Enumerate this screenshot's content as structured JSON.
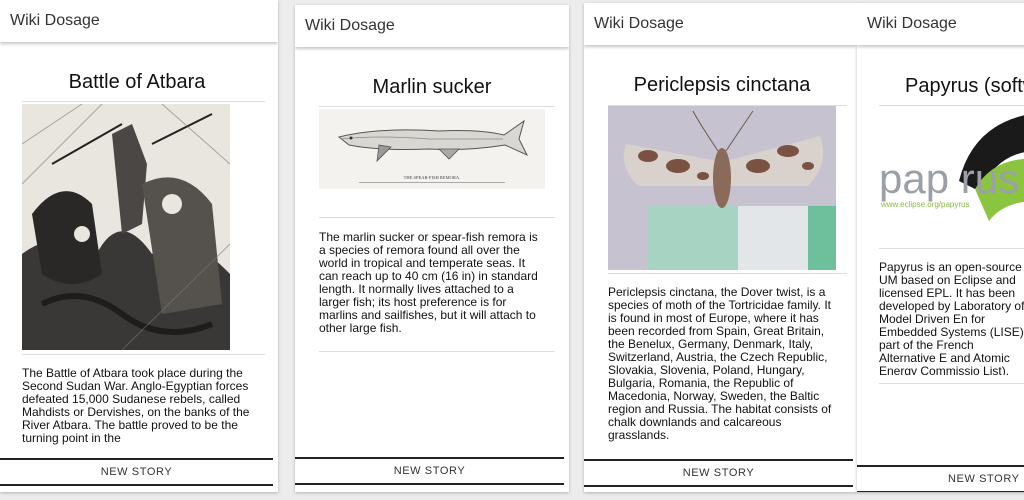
{
  "cards": [
    {
      "app_title": "Wiki Dosage",
      "title": "Battle of Atbara",
      "image_icon": "battle-illustration",
      "summary": "The Battle of Atbara took place during the Second Sudan War. Anglo-Egyptian forces defeated 15,000 Sudanese rebels, called Mahdists or Dervishes, on the banks of the River Atbara. The battle proved to be the turning point in the",
      "button": "NEW STORY"
    },
    {
      "app_title": "Wiki Dosage",
      "title": "Marlin sucker",
      "image_icon": "fish-drawing",
      "image_caption": "THE SPEAR-FISH REMORA.",
      "summary": "The marlin sucker or spear-fish remora is a species of remora found all over the world in tropical and temperate seas. It can reach up to 40 cm (16 in) in standard length. It normally lives attached to a larger fish; its host preference is for marlins and sailfishes, but it will attach to other large fish.",
      "button": "NEW STORY"
    },
    {
      "app_title": "Wiki Dosage",
      "title": "Periclepsis cinctana",
      "image_icon": "moth-photo",
      "summary": "Periclepsis cinctana, the Dover twist, is a species of moth of the Tortricidae family. It is found in most of Europe, where it has been recorded from Spain, Great Britain, the Benelux, Germany, Denmark, Italy, Switzerland, Austria, the Czech Republic, Slovakia, Slovenia, Poland, Hungary, Bulgaria, Romania, the Republic of Macedonia, Norway, Sweden, the Baltic region and Russia. The habitat consists of chalk downlands and calcareous grasslands.",
      "button": "NEW STORY"
    },
    {
      "app_title": "Wiki Dosage",
      "title": "Papyrus (softw",
      "image_icon": "papyrus-logo",
      "logo_text": "pap rus",
      "logo_url": "www.eclipse.org/papyrus",
      "summary": "Papyrus is an open-source UM based on Eclipse and licensed EPL. It has been developed by Laboratory of Model Driven En for Embedded Systems (LISE) part of the French Alternative E and Atomic Energy Commissio List).",
      "button": "NEW STORY"
    }
  ],
  "colors": {
    "background": "#ececec",
    "card": "#ffffff",
    "divider": "#dddddd",
    "button_border": "#222222"
  }
}
